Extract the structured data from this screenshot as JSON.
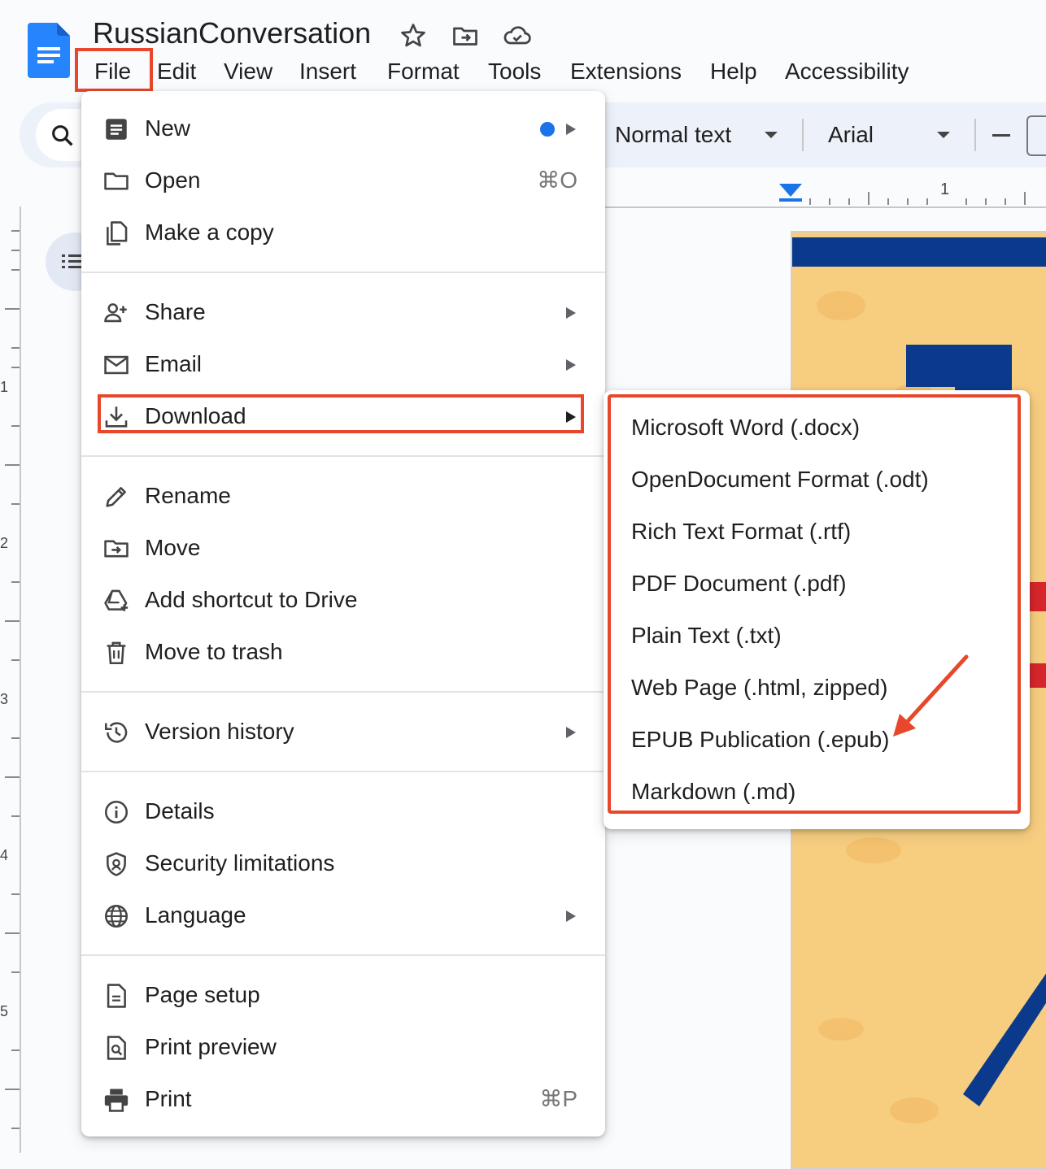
{
  "document": {
    "title": "RussianConversation"
  },
  "menubar": {
    "items": [
      "File",
      "Edit",
      "View",
      "Insert",
      "Format",
      "Tools",
      "Extensions",
      "Help",
      "Accessibility"
    ]
  },
  "toolbar": {
    "style": "Normal text",
    "font": "Arial"
  },
  "ruler": {
    "top_label": "1",
    "left_labels": [
      "1",
      "2",
      "3",
      "4",
      "5"
    ]
  },
  "file_menu": {
    "new": "New",
    "open": "Open",
    "open_shortcut": "⌘O",
    "make_copy": "Make a copy",
    "share": "Share",
    "email": "Email",
    "download": "Download",
    "rename": "Rename",
    "move": "Move",
    "add_shortcut": "Add shortcut to Drive",
    "move_to_trash": "Move to trash",
    "version_history": "Version history",
    "details": "Details",
    "security_limitations": "Security limitations",
    "language": "Language",
    "page_setup": "Page setup",
    "print_preview": "Print preview",
    "print": "Print",
    "print_shortcut": "⌘P"
  },
  "download_submenu": {
    "items": [
      "Microsoft Word (.docx)",
      "OpenDocument Format (.odt)",
      "Rich Text Format (.rtf)",
      "PDF Document (.pdf)",
      "Plain Text (.txt)",
      "Web Page (.html, zipped)",
      "EPUB Publication (.epub)",
      "Markdown (.md)"
    ]
  },
  "colors": {
    "accent_blue": "#1a73e8",
    "highlight_red": "#e8472b",
    "page_background": "#f9fbfd",
    "toolbar_background": "#edf2fa"
  },
  "icons": {
    "doc_logo": "google-docs-icon",
    "star": "star-icon",
    "move_folder": "move-to-folder-icon",
    "cloud_status": "cloud-done-icon",
    "search": "search-icon"
  }
}
